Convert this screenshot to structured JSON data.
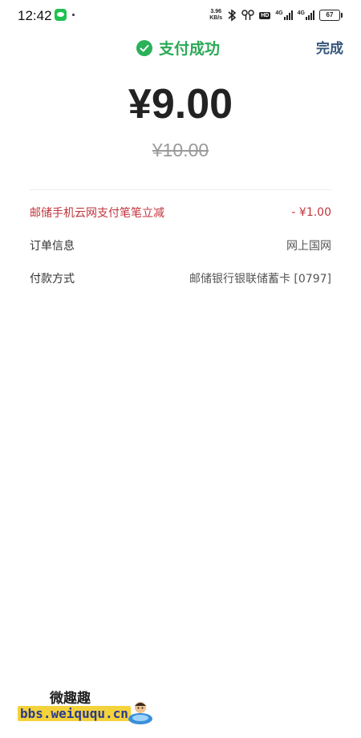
{
  "status_bar": {
    "time": "12:42",
    "speed_value": "3.96",
    "speed_unit": "KB/s",
    "hd_label": "HD",
    "network_1": "4G",
    "network_2": "4G",
    "battery": "67"
  },
  "header": {
    "status_text": "支付成功",
    "done_label": "完成"
  },
  "payment": {
    "amount": "¥9.00",
    "original_amount": "¥10.00"
  },
  "details": [
    {
      "label": "邮储手机云网支付笔笔立减",
      "value": "- ¥1.00"
    },
    {
      "label": "订单信息",
      "value": "网上国网"
    },
    {
      "label": "付款方式",
      "value": "邮储银行银联储蓄卡 [0797]"
    }
  ],
  "watermark": {
    "title": "微趣趣",
    "url": "bbs.weiququ.cn"
  }
}
